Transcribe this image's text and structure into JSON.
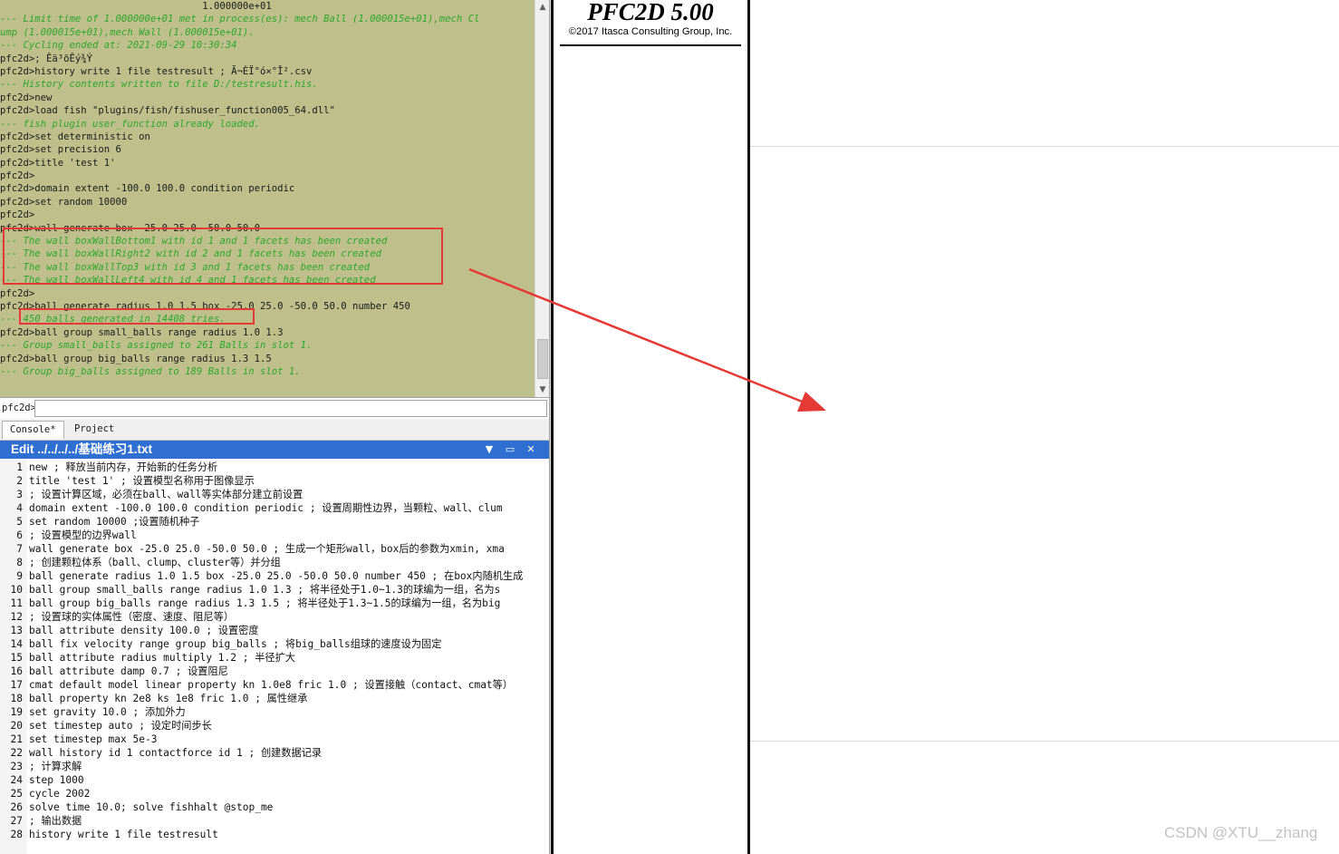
{
  "console": {
    "lines": [
      {
        "text": "                                   1.000000e+01",
        "kind": "cmd"
      },
      {
        "text": "--- Limit time of 1.000000e+01 met in process(es): mech Ball (1.000015e+01),mech Cl",
        "kind": "out"
      },
      {
        "text": "ump (1.000015e+01),mech Wall (1.000015e+01).",
        "kind": "out"
      },
      {
        "text": "--- Cycling ended at: 2021-09-29 10:30:34",
        "kind": "out"
      },
      {
        "text": "pfc2d>; Êä³öÊý¾Ý",
        "kind": "cmd"
      },
      {
        "text": "pfc2d>history write 1 file testresult ; Ã¬ÈÏ°ó×°Î².csv",
        "kind": "cmd"
      },
      {
        "text": "--- History contents written to file D:/testresult.his.",
        "kind": "out"
      },
      {
        "text": "pfc2d>new",
        "kind": "cmd"
      },
      {
        "text": "pfc2d>load fish \"plugins/fish/fishuser_function005_64.dll\"",
        "kind": "cmd"
      },
      {
        "text": "--- fish plugin user_function already loaded.",
        "kind": "out"
      },
      {
        "text": "pfc2d>set deterministic on",
        "kind": "cmd"
      },
      {
        "text": "pfc2d>set precision 6",
        "kind": "cmd"
      },
      {
        "text": "pfc2d>title 'test 1'",
        "kind": "cmd"
      },
      {
        "text": "pfc2d>",
        "kind": "cmd"
      },
      {
        "text": "pfc2d>domain extent -100.0 100.0 condition periodic",
        "kind": "cmd"
      },
      {
        "text": "pfc2d>set random 10000",
        "kind": "cmd"
      },
      {
        "text": "pfc2d>",
        "kind": "cmd"
      },
      {
        "text": "pfc2d>wall generate box -25.0 25.0 -50.0 50.0",
        "kind": "cmd"
      },
      {
        "text": "--- The wall boxWallBottom1 with id 1 and 1 facets has been created",
        "kind": "out"
      },
      {
        "text": "--- The wall boxWallRight2 with id 2 and 1 facets has been created",
        "kind": "out"
      },
      {
        "text": "--- The wall boxWallTop3 with id 3 and 1 facets has been created",
        "kind": "out"
      },
      {
        "text": "--- The wall boxWallLeft4 with id 4 and 1 facets has been created",
        "kind": "out"
      },
      {
        "text": "pfc2d>",
        "kind": "cmd"
      },
      {
        "text": "pfc2d>ball generate radius 1.0 1.5 box -25.0 25.0 -50.0 50.0 number 450",
        "kind": "cmd"
      },
      {
        "text": "--- 450 balls generated in 14408 tries.",
        "kind": "out"
      },
      {
        "text": "pfc2d>ball group small_balls range radius 1.0 1.3",
        "kind": "cmd"
      },
      {
        "text": "--- Group small_balls assigned to 261 Balls in slot 1.",
        "kind": "out"
      },
      {
        "text": "pfc2d>ball group big_balls range radius 1.3 1.5",
        "kind": "cmd"
      },
      {
        "text": "--- Group big_balls assigned to 189 Balls in slot 1.",
        "kind": "out"
      }
    ],
    "prompt_label": "pfc2d>",
    "input_value": "",
    "scroll_up_glyph": "▲",
    "scroll_down_glyph": "▼"
  },
  "tabs": [
    {
      "label": "Console*",
      "active": true
    },
    {
      "label": "Project",
      "active": false
    }
  ],
  "editor": {
    "title": "Edit ../../../../基础练习1.txt",
    "dropdown_glyph": "▼",
    "restore_glyph": "▭",
    "close_glyph": "✕",
    "lines": [
      {
        "num": "1",
        "text": "new ; 释放当前内存，开始新的任务分析"
      },
      {
        "num": "2",
        "text": "title 'test 1' ; 设置模型名称用于图像显示"
      },
      {
        "num": "3",
        "text": "; 设置计算区域，必须在ball、wall等实体部分建立前设置"
      },
      {
        "num": "4",
        "text": "domain extent -100.0 100.0 condition periodic ; 设置周期性边界，当颗粒、wall、clum"
      },
      {
        "num": "5",
        "text": "set random 10000 ;设置随机种子"
      },
      {
        "num": "6",
        "text": "; 设置模型的边界wall"
      },
      {
        "num": "7",
        "text": "wall generate box -25.0 25.0 -50.0 50.0 ; 生成一个矩形wall，box后的参数为xmin, xma"
      },
      {
        "num": "8",
        "text": "; 创建颗粒体系（ball、clump、cluster等）并分组"
      },
      {
        "num": "9",
        "text": "ball generate radius 1.0 1.5 box -25.0 25.0 -50.0 50.0 number 450 ; 在box内随机生成"
      },
      {
        "num": "10",
        "text": "ball group small_balls range radius 1.0 1.3 ; 将半径处于1.0~1.3的球编为一组，名为s"
      },
      {
        "num": "11",
        "text": "ball group big_balls range radius 1.3 1.5 ; 将半径处于1.3~1.5的球编为一组，名为big"
      },
      {
        "num": "12",
        "text": "; 设置球的实体属性（密度、速度、阻尼等）"
      },
      {
        "num": "13",
        "text": "ball attribute density 100.0 ; 设置密度"
      },
      {
        "num": "14",
        "text": "ball fix velocity range group big_balls ; 将big_balls组球的速度设为固定"
      },
      {
        "num": "15",
        "text": "ball attribute radius multiply 1.2 ; 半径扩大"
      },
      {
        "num": "16",
        "text": "ball attribute damp 0.7 ; 设置阻尼"
      },
      {
        "num": "17",
        "text": "cmat default model linear property kn 1.0e8 fric 1.0 ; 设置接触（contact、cmat等）"
      },
      {
        "num": "18",
        "text": "ball property kn 2e8 ks 1e8 fric 1.0 ; 属性继承"
      },
      {
        "num": "19",
        "text": "set gravity 10.0 ; 添加外力"
      },
      {
        "num": "20",
        "text": "set timestep auto ; 设定时间步长"
      },
      {
        "num": "21",
        "text": "set timestep max 5e-3"
      },
      {
        "num": "22",
        "text": "wall history id 1 contactforce id 1 ; 创建数据记录"
      },
      {
        "num": "23",
        "text": "; 计算求解"
      },
      {
        "num": "24",
        "text": "step 1000"
      },
      {
        "num": "25",
        "text": "cycle 2002"
      },
      {
        "num": "26",
        "text": "solve time 10.0; solve fishhalt @stop_me"
      },
      {
        "num": "27",
        "text": "; 输出数据"
      },
      {
        "num": "28",
        "text": "history write 1 file testresult"
      }
    ]
  },
  "pfc_panel": {
    "title": "PFC2D 5.00",
    "copyright": "©2017 Itasca Consulting Group, Inc."
  },
  "watermark": "CSDN @XTU__zhang",
  "colors": {
    "console_bg": "#bfbf8c",
    "console_output": "#2aa82a",
    "editor_title_bg": "#2f6fd1",
    "annotation_red": "#e53935"
  }
}
